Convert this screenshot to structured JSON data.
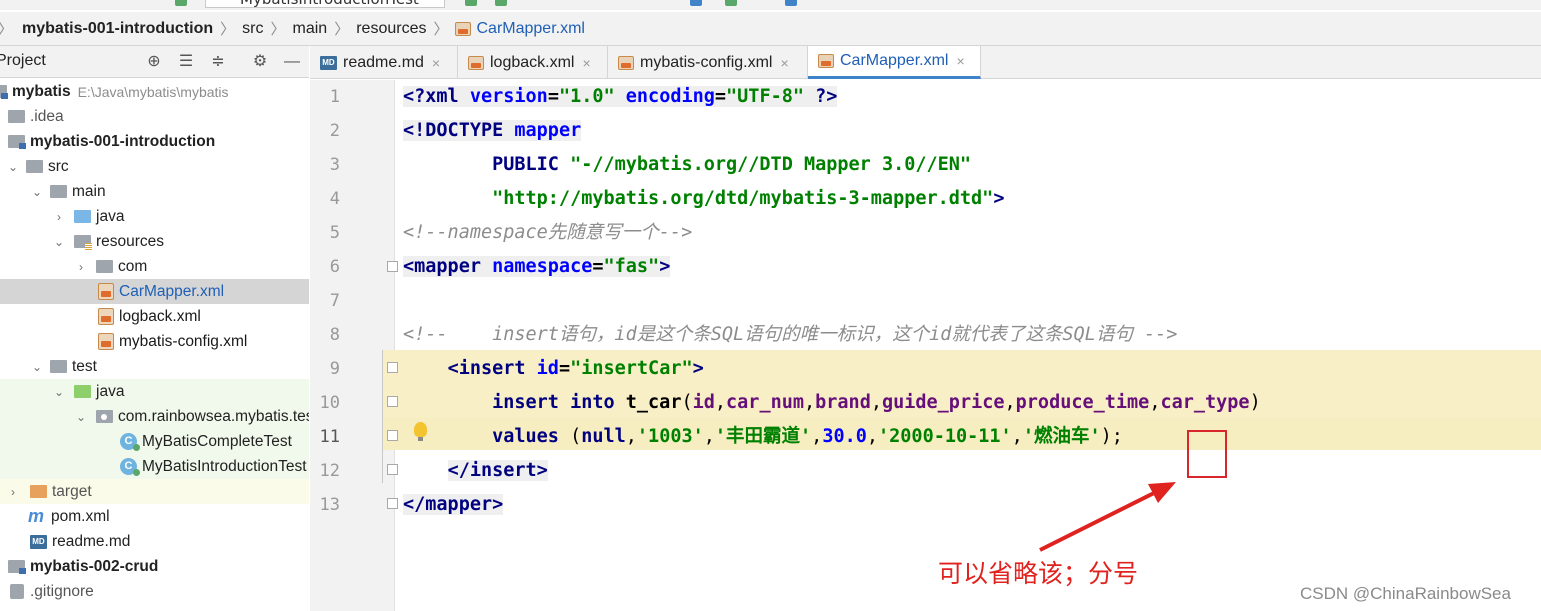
{
  "toolbar": {
    "run_config": "MybatisIntroductionTest"
  },
  "breadcrumb": {
    "items": [
      "mybatis-001-introduction",
      "src",
      "main",
      "resources",
      "CarMapper.xml"
    ]
  },
  "project_panel": {
    "title": "Project",
    "tree": [
      {
        "label": "mybatis",
        "path": "E:\\Java\\mybatis\\mybatis"
      },
      {
        "label": ".idea"
      },
      {
        "label": "mybatis-001-introduction"
      },
      {
        "label": "src"
      },
      {
        "label": "main"
      },
      {
        "label": "java"
      },
      {
        "label": "resources"
      },
      {
        "label": "com"
      },
      {
        "label": "CarMapper.xml"
      },
      {
        "label": "logback.xml"
      },
      {
        "label": "mybatis-config.xml"
      },
      {
        "label": "test"
      },
      {
        "label": "java"
      },
      {
        "label": "com.rainbowsea.mybatis.test"
      },
      {
        "label": "MyBatisCompleteTest"
      },
      {
        "label": "MyBatisIntroductionTest"
      },
      {
        "label": "target"
      },
      {
        "label": "pom.xml"
      },
      {
        "label": "readme.md"
      },
      {
        "label": "mybatis-002-crud"
      },
      {
        "label": ".gitignore"
      }
    ]
  },
  "tabs": [
    {
      "label": "readme.md",
      "icon": "markdown-icon",
      "active": false
    },
    {
      "label": "logback.xml",
      "icon": "xml-file-icon",
      "active": false
    },
    {
      "label": "mybatis-config.xml",
      "icon": "xml-file-icon",
      "active": false
    },
    {
      "label": "CarMapper.xml",
      "icon": "xml-file-icon",
      "active": true
    }
  ],
  "tab_close_glyph": "×",
  "editor": {
    "line_numbers": [
      "1",
      "2",
      "3",
      "4",
      "5",
      "6",
      "7",
      "8",
      "9",
      "10",
      "11",
      "12",
      "13"
    ],
    "current_line": "11",
    "lines": [
      [
        {
          "t": "pi",
          "v": "<?"
        },
        {
          "t": "tag",
          "v": "xml "
        },
        {
          "t": "attr",
          "v": "version"
        },
        {
          "t": "plain",
          "v": "="
        },
        {
          "t": "val",
          "v": "\"1.0\" "
        },
        {
          "t": "attr",
          "v": "encoding"
        },
        {
          "t": "plain",
          "v": "="
        },
        {
          "t": "val",
          "v": "\"UTF-8\" "
        },
        {
          "t": "pi",
          "v": "?>"
        }
      ],
      [
        {
          "t": "tag",
          "v": "<!DOCTYPE "
        },
        {
          "t": "attr",
          "v": "mapper"
        }
      ],
      [
        {
          "t": "txt",
          "v": "        "
        },
        {
          "t": "tag",
          "v": "PUBLIC "
        },
        {
          "t": "val",
          "v": "\"-//mybatis.org//DTD Mapper 3.0//EN\""
        }
      ],
      [
        {
          "t": "txt",
          "v": "        "
        },
        {
          "t": "val",
          "v": "\"http://mybatis.org/dtd/mybatis-3-mapper.dtd\""
        },
        {
          "t": "tag",
          "v": ">"
        }
      ],
      [
        {
          "t": "cmt",
          "v": "<!--namespace先随意写一个-->"
        }
      ],
      [
        {
          "t": "tag",
          "v": "<mapper "
        },
        {
          "t": "attr",
          "v": "namespace"
        },
        {
          "t": "plain",
          "v": "="
        },
        {
          "t": "val",
          "v": "\"fas\""
        },
        {
          "t": "tag",
          "v": ">"
        }
      ],
      [],
      [
        {
          "t": "cmt",
          "v": "<!--    insert语句，id是这个条SQL语句的唯一标识，这个id就代表了这条SQL语句 -->"
        }
      ],
      [
        {
          "t": "txt",
          "v": "    "
        },
        {
          "t": "tag",
          "v": "<insert "
        },
        {
          "t": "attr",
          "v": "id"
        },
        {
          "t": "plain",
          "v": "="
        },
        {
          "t": "val",
          "v": "\"insertCar\""
        },
        {
          "t": "tag",
          "v": ">"
        }
      ],
      [
        {
          "t": "txt",
          "v": "        "
        },
        {
          "t": "kw",
          "v": "insert into "
        },
        {
          "t": "plain",
          "v": "t_car"
        },
        {
          "t": "txt",
          "v": "("
        },
        {
          "t": "col",
          "v": "id"
        },
        {
          "t": "txt",
          "v": ","
        },
        {
          "t": "col",
          "v": "car_num"
        },
        {
          "t": "txt",
          "v": ","
        },
        {
          "t": "col",
          "v": "brand"
        },
        {
          "t": "txt",
          "v": ","
        },
        {
          "t": "col",
          "v": "guide_price"
        },
        {
          "t": "txt",
          "v": ","
        },
        {
          "t": "col",
          "v": "produce_time"
        },
        {
          "t": "txt",
          "v": ","
        },
        {
          "t": "col",
          "v": "car_type"
        },
        {
          "t": "txt",
          "v": ")"
        }
      ],
      [
        {
          "t": "txt",
          "v": "        "
        },
        {
          "t": "kw",
          "v": "values "
        },
        {
          "t": "txt",
          "v": "("
        },
        {
          "t": "kw",
          "v": "null"
        },
        {
          "t": "txt",
          "v": ","
        },
        {
          "t": "str",
          "v": "'1003'"
        },
        {
          "t": "txt",
          "v": ","
        },
        {
          "t": "str",
          "v": "'丰田霸道'"
        },
        {
          "t": "txt",
          "v": ","
        },
        {
          "t": "num",
          "v": "30.0"
        },
        {
          "t": "txt",
          "v": ","
        },
        {
          "t": "str",
          "v": "'2000-10-11'"
        },
        {
          "t": "txt",
          "v": ","
        },
        {
          "t": "str",
          "v": "'燃油车'"
        },
        {
          "t": "txt",
          "v": ");"
        }
      ],
      [
        {
          "t": "txt",
          "v": "    "
        },
        {
          "t": "tag",
          "v": "</insert>"
        }
      ],
      [
        {
          "t": "tag",
          "v": "</mapper>"
        }
      ]
    ]
  },
  "annotation": {
    "text": "可以省略该；分号",
    "color": "#e0231f"
  },
  "watermark": "CSDN @ChinaRainbowSea",
  "colors": {
    "accent_tab": "#4083c9",
    "xml_tag": "#000080",
    "xml_attr": "#0000ff",
    "xml_value": "#008000",
    "comment": "#8c8c8c",
    "sql_column": "#660e7a",
    "insert_highlight": "#f8efc6"
  }
}
